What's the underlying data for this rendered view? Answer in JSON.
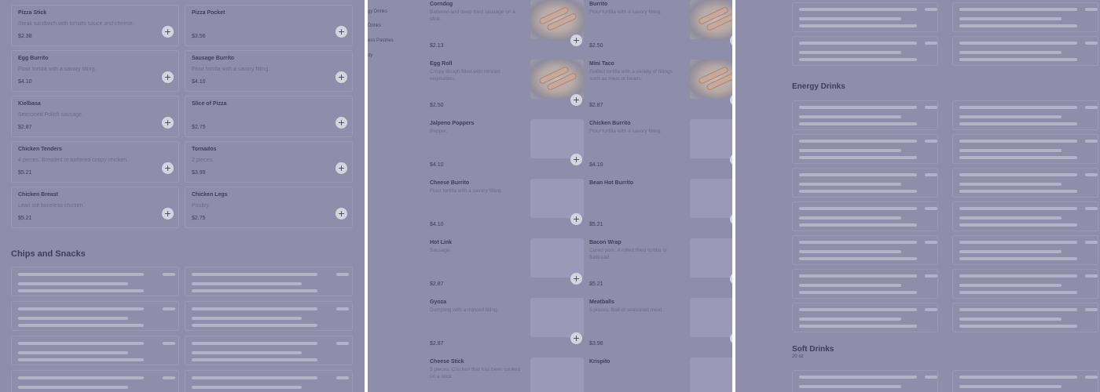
{
  "panel1": {
    "items": [
      {
        "name": "Pizza Stick",
        "desc": "Steak sandwich with tomato sauce and cheese.",
        "price": "$2.38"
      },
      {
        "name": "Pizza Pocket",
        "desc": "",
        "price": "$3.56"
      },
      {
        "name": "Egg Burrito",
        "desc": "Flour tortilla with a savory filling.",
        "price": "$4.10"
      },
      {
        "name": "Sausage Burrito",
        "desc": "Flour tortilla with a savory filling.",
        "price": "$4.10"
      },
      {
        "name": "Kielbasa",
        "desc": "Seasoned Polish sausage.",
        "price": "$2.87"
      },
      {
        "name": "Slice of Pizza",
        "desc": "",
        "price": "$2.75"
      },
      {
        "name": "Chicken Tenders",
        "desc": "4 pieces. Breaded or battered crispy chicken.",
        "price": "$5.21"
      },
      {
        "name": "Tornados",
        "desc": "2 pieces.",
        "price": "$3.99"
      },
      {
        "name": "Chicken Breast",
        "desc": "Lean cut boneless chicken.",
        "price": "$5.21"
      },
      {
        "name": "Chicken Legs",
        "desc": "Poultry.",
        "price": "$2.75"
      }
    ],
    "section_title": "Chips and Snacks"
  },
  "panel2": {
    "nav": [
      "gy Drinks",
      "Drinks",
      "ess Pastries",
      "dy"
    ],
    "items": [
      {
        "name": "Corndog",
        "desc": "Battered and deep fried sausage on a stick.",
        "price": "$2.13",
        "has_image": true
      },
      {
        "name": "Burrito",
        "desc": "Flour tortilla with a savory filling.",
        "price": "$2.50",
        "has_image": true
      },
      {
        "name": "Egg Roll",
        "desc": "Crispy dough filled with minced vegetables.",
        "price": "$2.50",
        "has_image": true
      },
      {
        "name": "Mini Taco",
        "desc": "Folded tortilla with a variety of fillings such as meat or beans.",
        "price": "$2.87",
        "has_image": true
      },
      {
        "name": "Jalpeno Poppers",
        "desc": "Pepper.",
        "price": "$4.10",
        "has_image": false
      },
      {
        "name": "Chicken Burrito",
        "desc": "Flour tortilla with a savory filling.",
        "price": "$4.10",
        "has_image": false
      },
      {
        "name": "Cheese Burrito",
        "desc": "Flour tortilla with a savory filling.",
        "price": "$4.10",
        "has_image": false
      },
      {
        "name": "Bean Hot Burrito",
        "desc": "",
        "price": "$5.21",
        "has_image": false
      },
      {
        "name": "Hot Link",
        "desc": "Sausage.",
        "price": "$2.87",
        "has_image": false
      },
      {
        "name": "Bacon Wrap",
        "desc": "Cured pork. A rolled filled tortilla or flatbread.",
        "price": "$5.21",
        "has_image": false
      },
      {
        "name": "Gyoza",
        "desc": "Dumpling with a minced filling.",
        "price": "$2.87",
        "has_image": false
      },
      {
        "name": "Meatballs",
        "desc": "5 pieces. Ball of seasoned meat.",
        "price": "$3.98",
        "has_image": false
      },
      {
        "name": "Cheese Stick",
        "desc": "5 pieces. Chicken that has been cooked on a stick.",
        "price": "",
        "has_image": false
      },
      {
        "name": "Krispito",
        "desc": "",
        "price": "",
        "has_image": false
      }
    ]
  },
  "panel3": {
    "section_energy": "Energy Drinks",
    "section_soft": "Soft Drinks",
    "soft_sub": "20 oz"
  },
  "icons": {
    "add": "+"
  },
  "colors": {
    "overlay": "#8e8eab",
    "text": "#3e3e55",
    "muted": "#6c6c88"
  }
}
